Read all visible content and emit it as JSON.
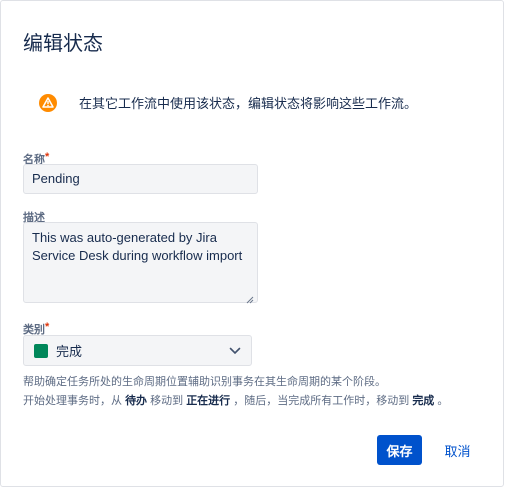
{
  "dialog": {
    "title": "编辑状态"
  },
  "warning": {
    "icon": "warning-icon",
    "color": "#ff8b00",
    "text": "在其它工作流中使用该状态，编辑状态将影响这些工作流。"
  },
  "fields": {
    "name": {
      "label": "名称",
      "required_mark": "*",
      "value": "Pending"
    },
    "description": {
      "label": "描述",
      "value": "This was auto-generated by Jira Service Desk during workflow import"
    },
    "category": {
      "label": "类别",
      "required_mark": "*",
      "value": "完成",
      "swatch_color": "#00875a"
    }
  },
  "help": {
    "line1": "帮助确定任务所处的生命周期位置辅助识别事务在其生命周期的某个阶段。",
    "line2_prefix": "开始处理事务时，从",
    "from": "待办",
    "move_to": "移动到",
    "to": "正在进行",
    "line2_mid": "，随后，当完成所有工作时，移动到",
    "done": "完成",
    "line2_end": "。"
  },
  "buttons": {
    "save": "保存",
    "cancel": "取消"
  },
  "colors": {
    "primary": "#0052cc",
    "required": "#de350b"
  }
}
